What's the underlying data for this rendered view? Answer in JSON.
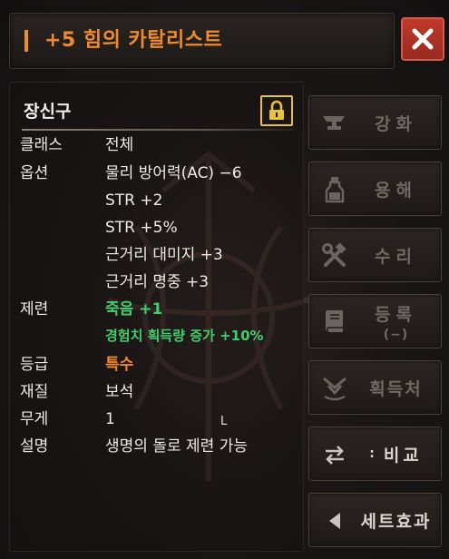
{
  "window": {
    "title": "+5 힘의 카탈리스트"
  },
  "item": {
    "type": "장신구",
    "rows": [
      {
        "label": "클래스",
        "value": "전체"
      },
      {
        "label": "옵션",
        "value": "물리 방어력(AC) −6"
      },
      {
        "label": "",
        "value": "STR +2"
      },
      {
        "label": "",
        "value": "STR +5%"
      },
      {
        "label": "",
        "value": "근거리 대미지 +3"
      },
      {
        "label": "",
        "value": "근거리 명중 +3"
      },
      {
        "label": "제련",
        "value": "죽음 +1"
      },
      {
        "label": "",
        "value": "경험치 획득량 증가 +10%"
      },
      {
        "label": "등급",
        "value": "특수"
      },
      {
        "label": "재질",
        "value": "보석"
      },
      {
        "label": "무게",
        "value": "1"
      },
      {
        "label": "설명",
        "value": "생명의 돌로 제련 가능"
      }
    ],
    "cursor_text": "L"
  },
  "actions": {
    "enhance": {
      "label": "강화",
      "icon": "anvil-icon"
    },
    "dissolve": {
      "label": "용해",
      "icon": "potion-bottle-icon"
    },
    "repair": {
      "label": "수리",
      "icon": "hammer-wrench-icon"
    },
    "register": {
      "label": "등록",
      "sub": "(−)",
      "icon": "book-icon"
    },
    "source": {
      "label": "획득처",
      "icon": "drop-location-icon"
    },
    "compare": {
      "label": "비교",
      "prefix": ":",
      "icon": "swap-arrows-icon"
    },
    "set_effect": {
      "label": "세트효과",
      "icon": "triangle-left-icon"
    }
  },
  "colors": {
    "accent_orange": "#f08a2c",
    "refine_green": "#3fd06b",
    "close_red": "#c0392b",
    "lock_gold": "#e8c23a",
    "disabled_text": "#706963"
  }
}
